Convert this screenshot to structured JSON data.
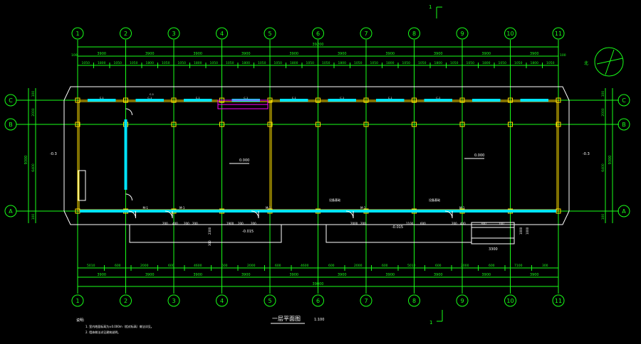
{
  "drawing": {
    "section_mark_top": "1",
    "section_mark_bottom": "1",
    "title": "一层平面图",
    "scale": "1:100",
    "notes_heading": "说明:",
    "notes": [
      "1. 室内地面标高为±0.000m（相对标高）做法详见。",
      "2. 墙体做法详见建筑说明。"
    ]
  },
  "axes": {
    "columns": [
      "1",
      "2",
      "3",
      "4",
      "5",
      "6",
      "7",
      "8",
      "9",
      "10",
      "11"
    ],
    "rows": [
      "C",
      "B",
      "A"
    ]
  },
  "dimensions": {
    "top_total": "39200",
    "top_bays": [
      "3900",
      "3900",
      "3900",
      "3900",
      "3900",
      "3900",
      "3900",
      "3900",
      "3900",
      "3900"
    ],
    "top_details": [
      "1050",
      "1800",
      "1050",
      "1050",
      "1800",
      "1050",
      "1050",
      "1800",
      "1050",
      "1050",
      "1800",
      "1050",
      "1050",
      "1800",
      "1050",
      "1050",
      "1800",
      "1050",
      "1050",
      "1800",
      "1050",
      "1050",
      "1800",
      "1050",
      "1050",
      "1800",
      "1050",
      "1050",
      "1800",
      "1050"
    ],
    "bottom_details": [
      "5010",
      "600",
      "2000",
      "600",
      "4600",
      "600",
      "2000",
      "600",
      "4600",
      "600",
      "2000",
      "600",
      "5010",
      "600",
      "2000",
      "600",
      "7100",
      "300"
    ],
    "bottom_bays": [
      "3900",
      "3900",
      "3900",
      "3900",
      "3900",
      "3900",
      "3900",
      "3900",
      "3900",
      "3900"
    ],
    "bottom_total": "39000",
    "left_total": "9300",
    "left_parts": [
      "100",
      "2000",
      "6400",
      "100"
    ],
    "right_total": "9300",
    "right_parts": [
      "100",
      "2000",
      "6400",
      "100"
    ],
    "edge_left": "100",
    "edge_right": "100",
    "ramp_width": "3300",
    "ramp_height": "1000",
    "step_vertical": "1000",
    "vertical_dims": [
      "2300",
      "300"
    ]
  },
  "labels": {
    "window_top": "C-1",
    "windows_top": [
      "C-1",
      "C-1",
      "C-1",
      "C-1",
      "C-1",
      "C-1",
      "C-1",
      "C-1"
    ],
    "level_main": "0.000",
    "level_right": "0.000",
    "level_left": "-0.3",
    "level_right_side": "-0.3",
    "level_ext1": "-0.015",
    "level_ext2": "-0.015",
    "door_labels": [
      "M-1",
      "M-1",
      "M-1",
      "M-1",
      "M-1"
    ],
    "tag1": "设备基础",
    "tag2": "设备基础",
    "misc_dims": [
      "200",
      "400",
      "200",
      "200",
      "1900",
      "200",
      "200",
      "2000",
      "200",
      "1100",
      "600",
      "200",
      "400",
      "300",
      "100"
    ]
  },
  "colors": {
    "axis_green": "#19ff19",
    "wall_white": "#ffffff",
    "column_yellow": "#ffe000",
    "window_cyan": "#00e5ff",
    "highlight_magenta": "#ff00ff"
  }
}
